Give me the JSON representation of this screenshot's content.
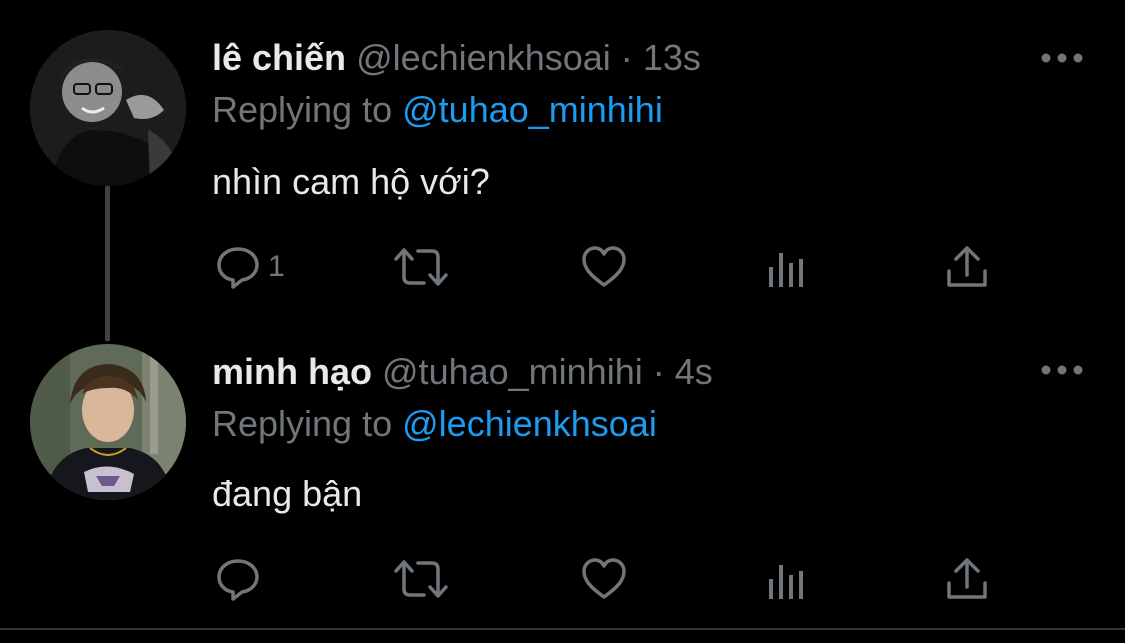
{
  "tweets": [
    {
      "name": "lê chiến",
      "handle": "@lechienkhsoai",
      "separator": "·",
      "time": "13s",
      "replying_label": "Replying to",
      "replying_to": "@tuhao_minhihi",
      "text": "nhìn cam hộ với?",
      "reply_count": "1"
    },
    {
      "name": "minh hạo",
      "handle": "@tuhao_minhihi",
      "separator": "·",
      "time": "4s",
      "replying_label": "Replying to",
      "replying_to": "@lechienkhsoai",
      "text": "đang bận",
      "reply_count": ""
    }
  ],
  "colors": {
    "background": "#000000",
    "primary_text": "#e7e9ea",
    "secondary_text": "#71767b",
    "accent": "#1d9bf0",
    "thread_line": "#3e4144"
  },
  "icons": [
    "reply-icon",
    "retweet-icon",
    "like-icon",
    "analytics-icon",
    "share-icon",
    "more-icon"
  ]
}
